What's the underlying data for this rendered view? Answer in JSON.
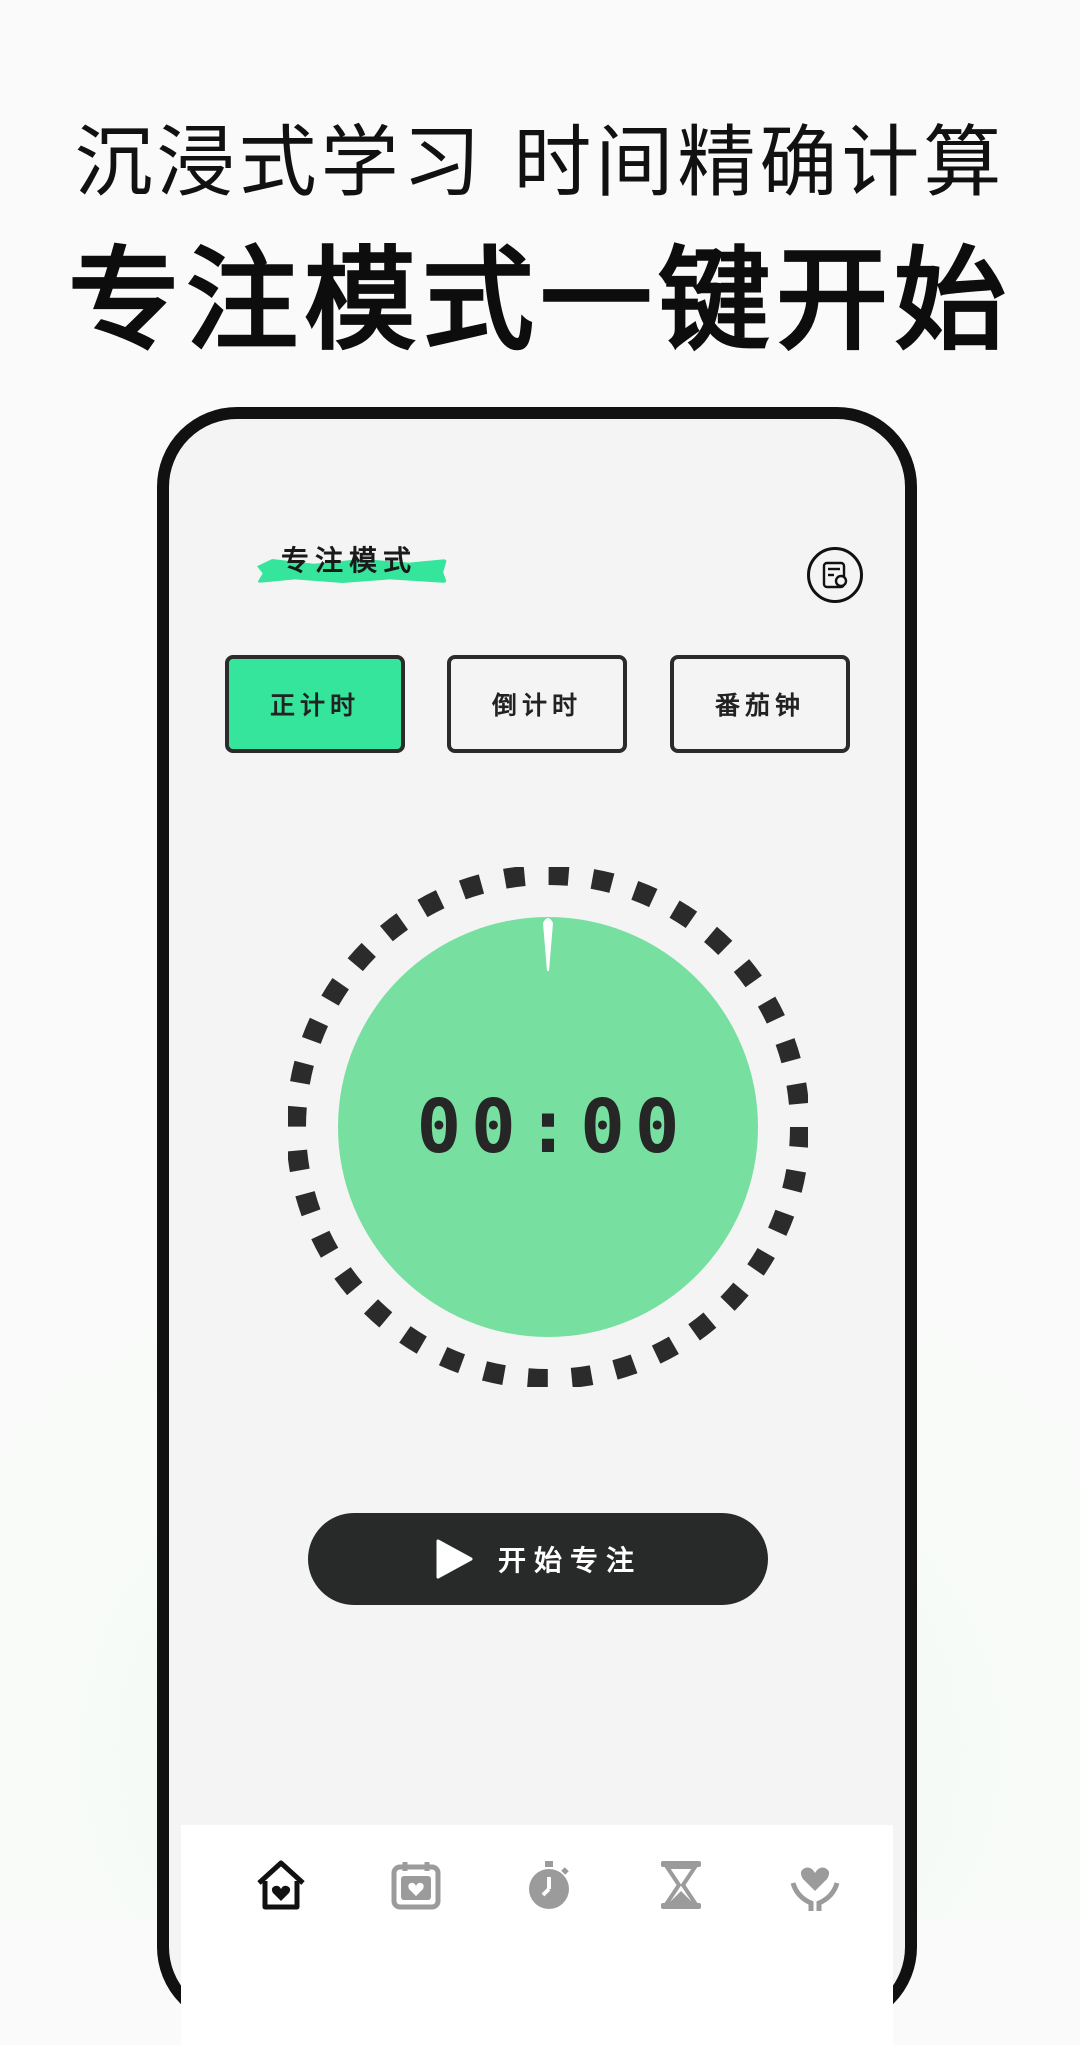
{
  "promo": {
    "line1": "沉浸式学习 时间精确计算",
    "line2": "专注模式一键开始"
  },
  "app": {
    "header_title": "专注模式",
    "record_icon": "record-calendar-icon",
    "tabs": [
      {
        "label": "正计时",
        "active": true
      },
      {
        "label": "倒计时",
        "active": false
      },
      {
        "label": "番茄钟",
        "active": false
      }
    ],
    "timer": {
      "display": "00:00"
    },
    "start_button": {
      "label": "开始专注",
      "icon": "play-icon"
    },
    "nav": [
      {
        "icon": "home-heart-icon",
        "active": true
      },
      {
        "icon": "calendar-heart-icon",
        "active": false
      },
      {
        "icon": "stopwatch-icon",
        "active": false
      },
      {
        "icon": "hourglass-icon",
        "active": false
      },
      {
        "icon": "hand-heart-icon",
        "active": false
      }
    ]
  },
  "colors": {
    "accent": "#35e59c",
    "dial_fill": "#77e0a0",
    "dark": "#282a29",
    "screen_bg": "#f4f4f4"
  }
}
